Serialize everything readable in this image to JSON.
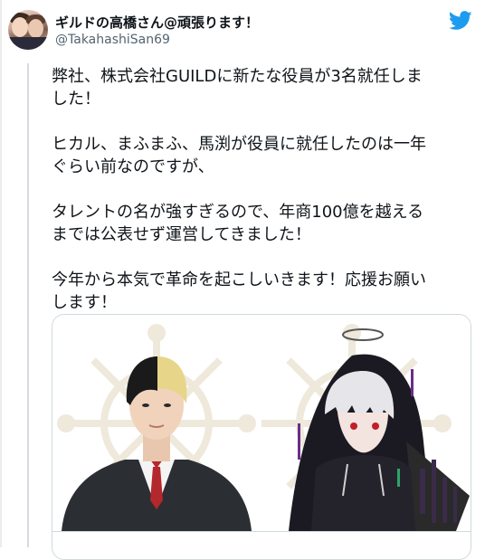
{
  "user": {
    "display_name": "ギルドの高橋さん@頑張ります！",
    "handle": "@TakahashiSan69"
  },
  "tweet": {
    "text": "弊社、株式会社GUILDに新たな役員が3名就任しま\nした！\n\nヒカル、まふまふ、馬渕が役員に就任したのは一年\nぐらい前なのですが、\n\nタレントの名が強すぎるので、年商100億を越える\nまでは公表せず運営してきました！\n\n今年から本気で革命を起こしいきます！応援お願い\nします！"
  },
  "icons": {
    "bird": "twitter-bird-icon",
    "avatar": "profile-avatar"
  },
  "colors": {
    "twitter_blue": "#1d9bf0",
    "text": "#0f1419",
    "secondary": "#536471",
    "border": "#cfd9de"
  }
}
